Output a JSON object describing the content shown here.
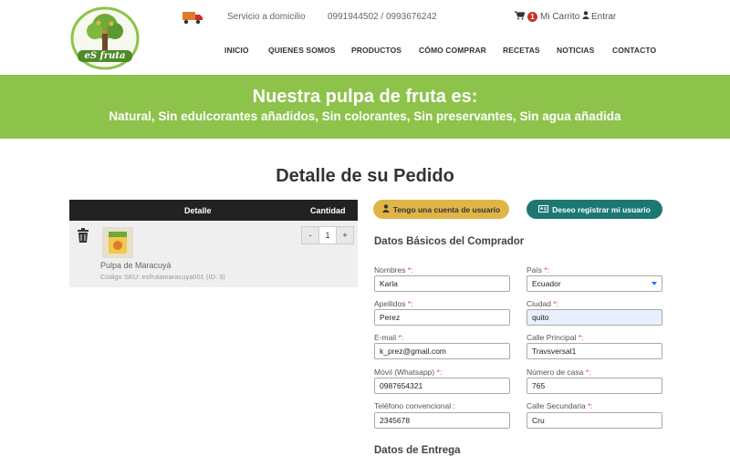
{
  "header": {
    "logo_text": "eS fruta",
    "delivery_text": "Servicio a domicilio",
    "phones": "0991944502 / 0993676242",
    "cart_count": "1",
    "cart_label": "Mi Carrito",
    "login_label": "Entrar",
    "nav": [
      "INICIO",
      "QUIENES SOMOS",
      "PRODUCTOS",
      "CÓMO COMPRAR",
      "RECETAS",
      "NOTICIAS",
      "CONTACTO"
    ]
  },
  "banner": {
    "title": "Nuestra pulpa de fruta es:",
    "subtitle": "Natural, Sin edulcorantes añadidos, Sin colorantes, Sin preservantes, Sin agua añadida"
  },
  "page_title": "Detalle de su Pedido",
  "cart": {
    "header_detail": "Detalle",
    "header_qty": "Cantidad",
    "items": [
      {
        "name": "Pulpa de Maracuyá",
        "sku": "Código SKU: esfrutamaracuya001 (ID: 3)",
        "quantity": "1",
        "minus": "-",
        "plus": "+"
      }
    ]
  },
  "buttons": {
    "have_account": "Tengo una cuenta de usuario",
    "register": "Deseo registrar mi usuario"
  },
  "form": {
    "section_title": "Datos Básicos del Comprador",
    "next_section_title": "Datos de Entrega",
    "required_mark": "*:",
    "fields": {
      "nombres": {
        "label": "Nombres",
        "value": "Karla"
      },
      "pais": {
        "label": "País",
        "value": "Ecuador"
      },
      "apellidos": {
        "label": "Apellidos",
        "value": "Perez"
      },
      "ciudad": {
        "label": "Ciudad",
        "value": "quito"
      },
      "email": {
        "label": "E-mail",
        "value": "k_prez@gmail.com"
      },
      "calle_principal": {
        "label": "Calle Principal",
        "value": "Travsversal1"
      },
      "movil": {
        "label": "Móvil (Whatsapp)",
        "value": "0987654321"
      },
      "numero_casa": {
        "label": "Número de casa",
        "value": "765"
      },
      "telefono": {
        "label": "Teléfono convencional",
        "label_suffix": ":",
        "value": "2345678"
      },
      "calle_secundaria": {
        "label": "Calle Secundaria",
        "value": "Cru"
      }
    }
  },
  "colors": {
    "banner_green": "#8dc34a",
    "account_button": "#e0b548",
    "register_button": "#1d7874",
    "table_header": "#222222",
    "badge_red": "#c8312b"
  }
}
